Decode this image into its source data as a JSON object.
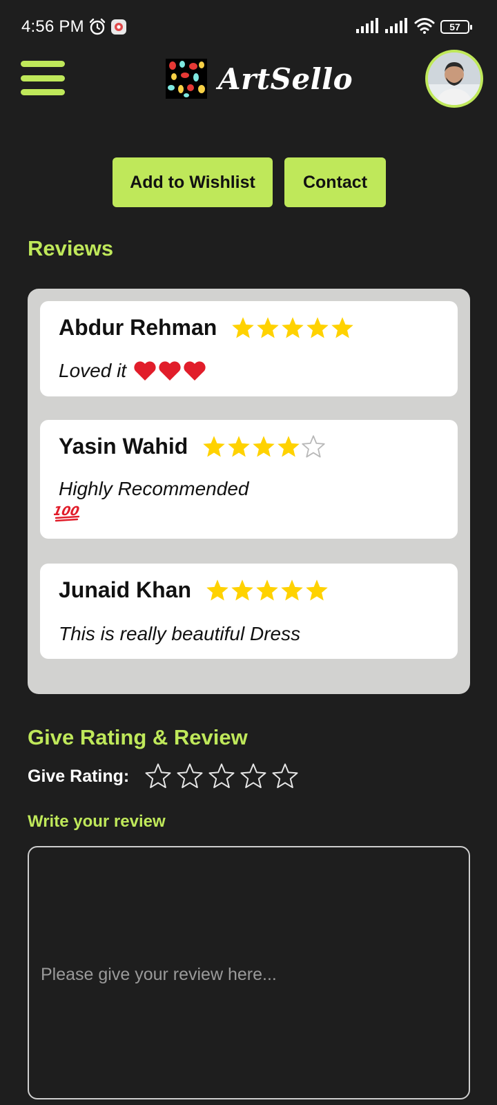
{
  "status_bar": {
    "time": "4:56 PM",
    "battery": "57",
    "icons": [
      "alarm-icon",
      "notification-icon",
      "signal-icon",
      "signal-icon",
      "wifi-icon",
      "battery-icon"
    ]
  },
  "header": {
    "menu_icon": "hamburger-menu-icon",
    "brand_name": "ArtSello",
    "logo_icon": "paint-splash-logo",
    "avatar_icon": "user-avatar"
  },
  "actions": {
    "wishlist_label": "Add to Wishlist",
    "contact_label": "Contact"
  },
  "reviews": {
    "title": "Reviews",
    "items": [
      {
        "name": "Abdur Rehman",
        "rating": 5,
        "text": "Loved it",
        "emoji": "three red hearts"
      },
      {
        "name": "Yasin Wahid",
        "rating": 4,
        "text": "Highly Recommended",
        "emoji": "hundred points"
      },
      {
        "name": "Junaid Khan",
        "rating": 5,
        "text": "This is really beautiful Dress",
        "emoji": ""
      }
    ]
  },
  "give_review": {
    "title": "Give Rating & Review",
    "rating_label": "Give Rating:",
    "rating_value": 0,
    "rating_max": 5,
    "write_label": "Write your review",
    "placeholder": "Please give your review here...",
    "value": ""
  },
  "colors": {
    "background": "#1e1e1e",
    "accent": "#bfe85a",
    "star": "#ffd200",
    "panel": "#d2d2d0",
    "card": "#ffffff"
  }
}
